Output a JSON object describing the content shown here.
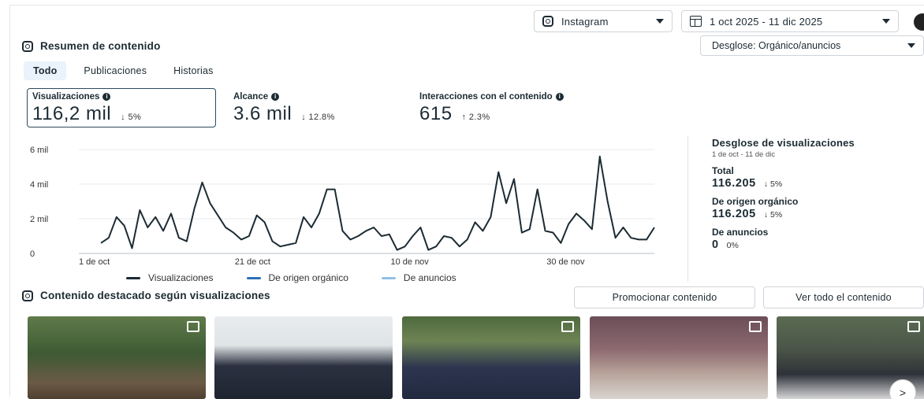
{
  "header": {
    "account_dropdown": "Instagram",
    "date_range": "1 oct 2025 - 11 dic 2025"
  },
  "overview": {
    "title": "Resumen de contenido",
    "breakdown_dropdown": "Desglose: Orgánico/anuncios",
    "tabs": [
      {
        "label": "Todo",
        "active": true
      },
      {
        "label": "Publicaciones",
        "active": false
      },
      {
        "label": "Historias",
        "active": false
      }
    ],
    "metrics": [
      {
        "label": "Visualizaciones",
        "value": "116,2 mil",
        "delta": "↓ 5%",
        "selected": true
      },
      {
        "label": "Alcance",
        "value": "3.6 mil",
        "delta": "↓ 12.8%",
        "selected": false
      },
      {
        "label": "Interacciones con el contenido",
        "value": "615",
        "delta": "↑ 2.3%",
        "selected": false
      }
    ]
  },
  "chart_data": {
    "type": "line",
    "x_tick_labels": [
      "1 de oct",
      "21 de oct",
      "10 de nov",
      "30 de nov"
    ],
    "y_tick_labels": [
      "6 mil",
      "4 mil",
      "2 mil",
      "0"
    ],
    "ylim": [
      0,
      6000
    ],
    "grid": true,
    "legend_position": "bottom",
    "series": [
      {
        "name": "Visualizaciones",
        "color": "#1c2b33",
        "values": [
          600,
          900,
          2100,
          1600,
          300,
          2500,
          1500,
          2100,
          1300,
          2300,
          900,
          700,
          2600,
          4100,
          2900,
          2200,
          1500,
          1200,
          800,
          1000,
          2200,
          1800,
          700,
          400,
          500,
          600,
          2100,
          1500,
          2300,
          3700,
          3700,
          1300,
          800,
          1000,
          1300,
          1500,
          1000,
          1100,
          200,
          400,
          1000,
          1500,
          200,
          400,
          1000,
          900,
          400,
          800,
          1800,
          1300,
          2100,
          4700,
          2900,
          4300,
          1200,
          1400,
          3700,
          1300,
          1200,
          600,
          1700,
          2300,
          1900,
          1400,
          5600,
          3000,
          900,
          1500,
          900,
          800,
          800,
          1500
        ]
      },
      {
        "name": "De origen orgánico",
        "color": "#2f6fb5",
        "values": []
      },
      {
        "name": "De anuncios",
        "color": "#8fc1e6",
        "values": []
      }
    ]
  },
  "breakdown": {
    "title": "Desglose de visualizaciones",
    "subtitle": "1 de oct - 11 de dic",
    "items": [
      {
        "label": "Total",
        "value": "116.205",
        "delta": "↓ 5%"
      },
      {
        "label": "De origen orgánico",
        "value": "116.205",
        "delta": "↓ 5%"
      },
      {
        "label": "De anuncios",
        "value": "0",
        "delta": "0%"
      }
    ]
  },
  "featured": {
    "title": "Contenido destacado según visualizaciones",
    "promote_button": "Promocionar contenido",
    "view_all_button": "Ver todo el contenido",
    "next_arrow": ">"
  }
}
